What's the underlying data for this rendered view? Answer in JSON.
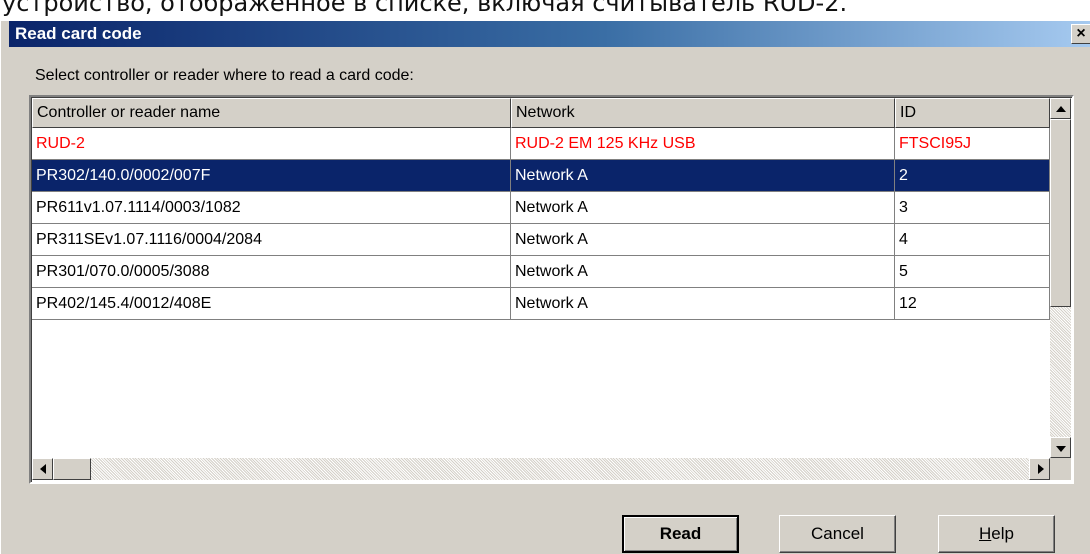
{
  "caption": "устройство, отображенное в списке, включая считыватель RUD-2.",
  "window": {
    "title": "Read card code",
    "close_glyph": "×"
  },
  "prompt": "Select controller or reader where to read a card code:",
  "table": {
    "columns": [
      "Controller or reader name",
      "Network",
      "ID"
    ],
    "rows": [
      {
        "name": "RUD-2",
        "network": "RUD-2 EM 125 KHz USB",
        "id": "FTSCI95J",
        "style": "red"
      },
      {
        "name": "PR302/140.0/0002/007F",
        "network": "Network A",
        "id": "2",
        "style": "selected"
      },
      {
        "name": "PR611v1.07.1114/0003/1082",
        "network": "Network A",
        "id": "3",
        "style": "normal"
      },
      {
        "name": "PR311SEv1.07.1116/0004/2084",
        "network": "Network A",
        "id": "4",
        "style": "normal"
      },
      {
        "name": "PR301/070.0/0005/3088",
        "network": "Network A",
        "id": "5",
        "style": "normal"
      },
      {
        "name": "PR402/145.4/0012/408E",
        "network": "Network A",
        "id": "12",
        "style": "normal"
      }
    ]
  },
  "buttons": {
    "read": "Read",
    "cancel": "Cancel",
    "help_mnemonic": "H",
    "help_rest": "elp"
  },
  "colors": {
    "title_gradient_start": "#0a246a",
    "title_gradient_end": "#a6caf0",
    "selection": "#0a246a",
    "highlight_text": "#ff0000",
    "dialog_face": "#d4d0c8"
  }
}
